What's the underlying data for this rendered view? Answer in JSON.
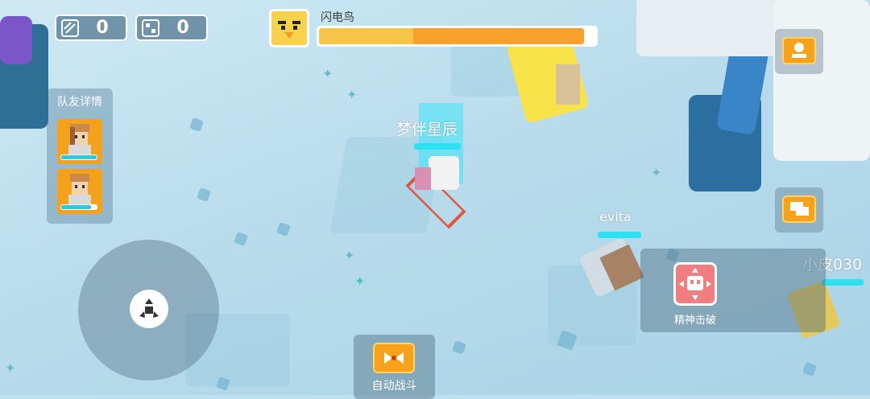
{
  "hud": {
    "counter_left": {
      "icon": "pencil-slash-icon",
      "value": "0"
    },
    "counter_right": {
      "icon": "piece-icon",
      "value": "0"
    }
  },
  "boss": {
    "name": "闪电鸟",
    "health_percent": 96
  },
  "team": {
    "title": "队友详情",
    "members": [
      {
        "hp_percent": 100
      },
      {
        "hp_percent": 85
      }
    ]
  },
  "players": {
    "self_name": "梦伴星辰",
    "ally1_name": "evita",
    "ally2_name": "小皮030"
  },
  "actions": {
    "skill_label": "精神击破",
    "auto_battle_label": "自动战斗",
    "emote_icon": "emote-icon",
    "chat_icon": "chat-icon"
  },
  "colors": {
    "accent_orange": "#f7a21b",
    "boss_bar": "#f7a12c",
    "hp_cyan": "#2ec9e0"
  }
}
